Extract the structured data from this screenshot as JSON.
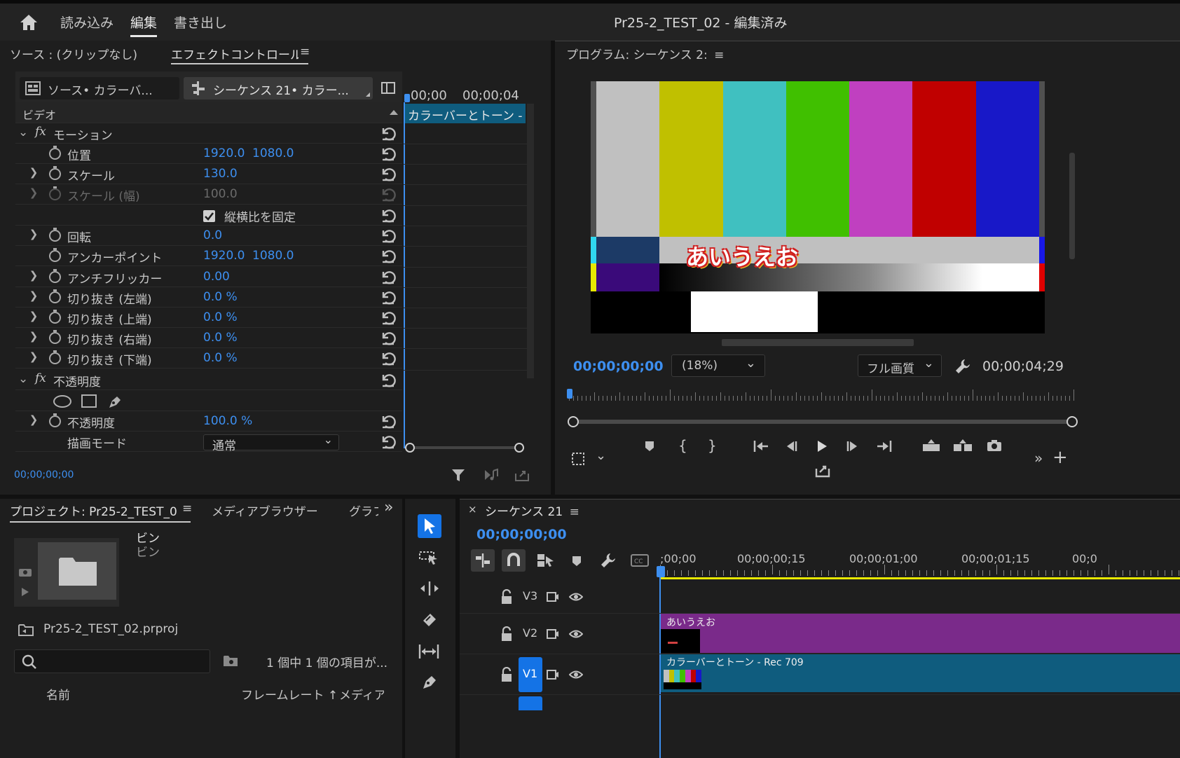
{
  "app": {
    "title": "Pr25-2_TEST_02 - 編集済み",
    "tabs": [
      {
        "label": "読み込み",
        "active": false
      },
      {
        "label": "編集",
        "active": true
      },
      {
        "label": "書き出し",
        "active": false
      }
    ]
  },
  "source_panel": {
    "tab_source": "ソース : (クリップなし)",
    "tab_effects": "エフェクトコントロール",
    "clip_source": "ソース• カラーバ...",
    "clip_sequence": "シーケンス 21• カラー...",
    "section_video": "ビデオ",
    "timecodes": [
      "00;00",
      "00;00;04"
    ],
    "clip_bar_label": "カラーバーとトーン - R",
    "footer_timecode": "00;00;00;00"
  },
  "effects": {
    "motion_label": "モーション",
    "rows": [
      {
        "label": "位置",
        "v1": "1920.0",
        "v2": "1080.0",
        "expand": false,
        "disabled": false
      },
      {
        "label": "スケール",
        "v1": "130.0",
        "v2": "",
        "expand": true,
        "disabled": false
      },
      {
        "label": "スケール (幅)",
        "v1": "100.0",
        "v2": "",
        "expand": true,
        "disabled": true
      },
      {
        "label": "回転",
        "v1": "0.0",
        "v2": "",
        "expand": true,
        "disabled": false
      },
      {
        "label": "アンカーポイント",
        "v1": "1920.0",
        "v2": "1080.0",
        "expand": false,
        "disabled": false
      },
      {
        "label": "アンチフリッカー",
        "v1": "0.00",
        "v2": "",
        "expand": true,
        "disabled": false
      },
      {
        "label": "切り抜き (左端)",
        "v1": "0.0 %",
        "v2": "",
        "expand": true,
        "disabled": false
      },
      {
        "label": "切り抜き (上端)",
        "v1": "0.0 %",
        "v2": "",
        "expand": true,
        "disabled": false
      },
      {
        "label": "切り抜き (右端)",
        "v1": "0.0 %",
        "v2": "",
        "expand": true,
        "disabled": false
      },
      {
        "label": "切り抜き (下端)",
        "v1": "0.0 %",
        "v2": "",
        "expand": true,
        "disabled": false
      }
    ],
    "uniform_scale_label": "縦横比を固定",
    "uniform_scale_checked": true,
    "opacity_section_label": "不透明度",
    "opacity_label": "不透明度",
    "opacity_value": "100.0 %",
    "blend_label": "描画モード",
    "blend_value": "通常"
  },
  "program": {
    "title": "プログラム: シーケンス 2:",
    "overlay_text": "あいうえお",
    "timecode_current": "00;00;00;00",
    "zoom": "(18%)",
    "quality": "フル画質",
    "timecode_duration": "00;00;04;29",
    "bars_top": [
      "#c0c0c0",
      "#c0c000",
      "#40c0c0",
      "#40c000",
      "#c040c0",
      "#c00000",
      "#1818c8"
    ]
  },
  "project": {
    "tab_project": "プロジェクト: Pr25-2_TEST_0",
    "tab_media": "メディアブラウザー",
    "tab_graphics": "グラフ",
    "bin_name": "ビン",
    "bin_sub": "ビン",
    "project_file": "Pr25-2_TEST_02.prproj",
    "item_count": "1 個中 1 個の項目が...",
    "col_name": "名前",
    "col_framerate": "フレームレート ↑",
    "col_media": "メディア"
  },
  "timeline": {
    "title": "シーケンス 21",
    "timecode": "00;00;00;00",
    "ruler": [
      ";00;00",
      "00;00;00;15",
      "00;00;01;00",
      "00;00;01;15",
      "00;0"
    ],
    "tracks": [
      {
        "name": "V3",
        "clip": ""
      },
      {
        "name": "V2",
        "clip": "あいうえお"
      },
      {
        "name": "V1",
        "clip": "カラーバーとトーン - Rec 709"
      }
    ]
  }
}
